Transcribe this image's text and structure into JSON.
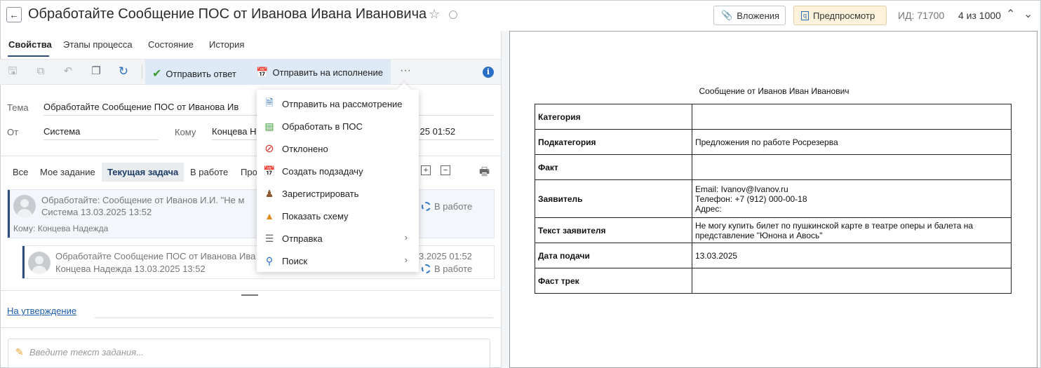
{
  "header": {
    "title": "Обработайте Сообщение ПОС от Иванова Ивана Ивановича",
    "attachments_label": "Вложения",
    "preview_label": "Предпросмотр",
    "id_label": "ИД: 71700",
    "count_label": "4 из 1000"
  },
  "tabs": [
    "Свойства",
    "Этапы процесса",
    "Состояние",
    "История"
  ],
  "toolbar": {
    "send_reply": "Отправить ответ",
    "send_execution": "Отправить на исполнение",
    "more": "···"
  },
  "fields": {
    "subject_label": "Тема",
    "subject_value": "Обработайте  Сообщение ПОС от Иванова Ив",
    "from_label": "От",
    "from_value": "Система",
    "to_label": "Кому",
    "to_value": "Концева Н",
    "date_value": "25 01:52"
  },
  "filters": [
    "Все",
    "Мое задание",
    "Текущая задача",
    "В работе",
    "Про"
  ],
  "tasks": [
    {
      "title": "Обработайте: Сообщение от Иванов И.И. \"Не м",
      "author": "Система  13.03.2025 13:52",
      "to": "Кому: Концева Надежда",
      "status": "В работе"
    },
    {
      "title": "Обработайте Сообщение ПОС от Иванова Ива",
      "author": "Концева Надежда  13.03.2025 13:52",
      "date": "3.2025 01:52",
      "status": "В работе"
    }
  ],
  "approval_link": "На утверждение",
  "task_placeholder": "Введите текст задания...",
  "menu": [
    {
      "label": "Отправить на рассмотрение",
      "icon": "document-send-icon"
    },
    {
      "label": "Обработать в ПОС",
      "icon": "process-icon"
    },
    {
      "label": "Отклонено",
      "icon": "rejected-icon"
    },
    {
      "label": "Создать подзадачу",
      "icon": "subtask-icon"
    },
    {
      "label": "Зарегистрировать",
      "icon": "stamp-icon"
    },
    {
      "label": "Показать схему",
      "icon": "scheme-icon"
    },
    {
      "label": "Отправка",
      "icon": "sending-icon"
    },
    {
      "label": "Поиск",
      "icon": "search-icon"
    }
  ],
  "document": {
    "title": "Сообщение от Иванов Иван Иванович",
    "rows": [
      {
        "key": "Категория",
        "value": ""
      },
      {
        "key": "Подкатегория",
        "value": "Предложения по работе Росрезерва"
      },
      {
        "key": "Факт",
        "value": ""
      },
      {
        "key": "Заявитель",
        "value": "Email: Ivanov@Ivanov.ru\nТелефон: +7 (912) 000-00-18\nАдрес:"
      },
      {
        "key": "Текст заявителя",
        "value": "Не могу купить билет по пушкинской карте в театре оперы и балета на представление \"Юнона и Авось\""
      },
      {
        "key": "Дата подачи",
        "value": "13.03.2025"
      },
      {
        "key": "Фаст трек",
        "value": ""
      }
    ]
  }
}
